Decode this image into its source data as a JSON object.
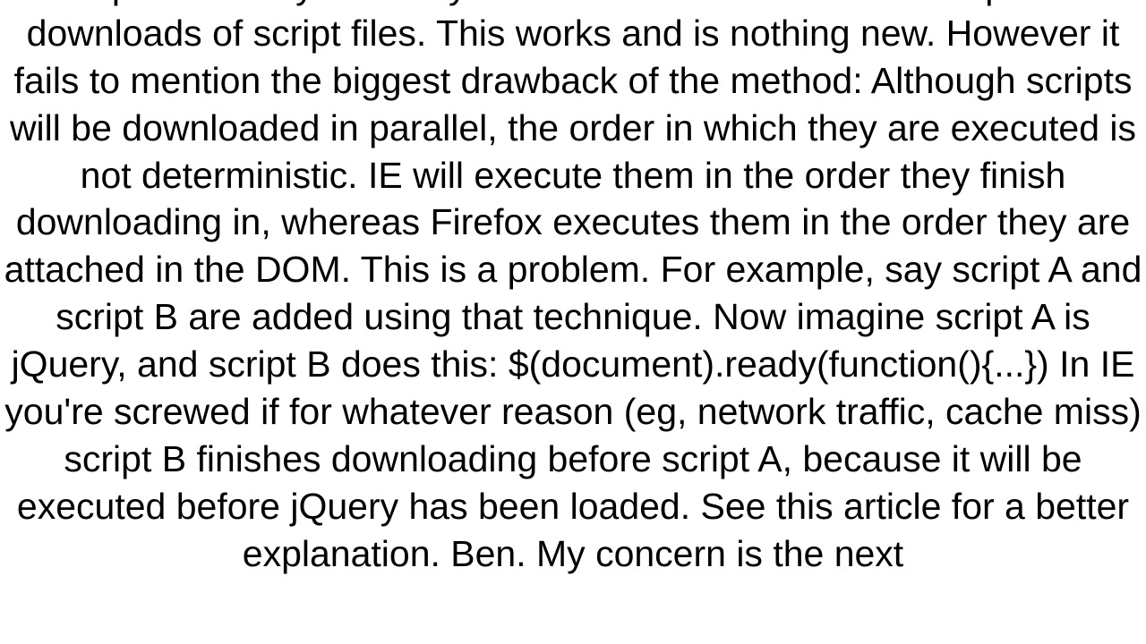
{
  "body": {
    "paragraph": "‹script› nodes dynamically in the DOM in order to achieve parallel downloads of script files. This works and is nothing new. However it fails to mention the biggest drawback of the method: Although scripts will be downloaded in parallel, the order in which they are executed is not deterministic. IE will execute them in the order they finish downloading in, whereas Firefox executes them in the order they are attached in the DOM. This is a problem. For example, say script A and script B are added using that technique. Now imagine script A is jQuery, and script B does this: $(document).ready(function(){...})  In IE you're screwed if for whatever reason (eg, network traffic, cache miss) script B finishes downloading before script A, because it will be executed before jQuery has been loaded. See this article for a better explanation. Ben. My concern is the next"
  }
}
